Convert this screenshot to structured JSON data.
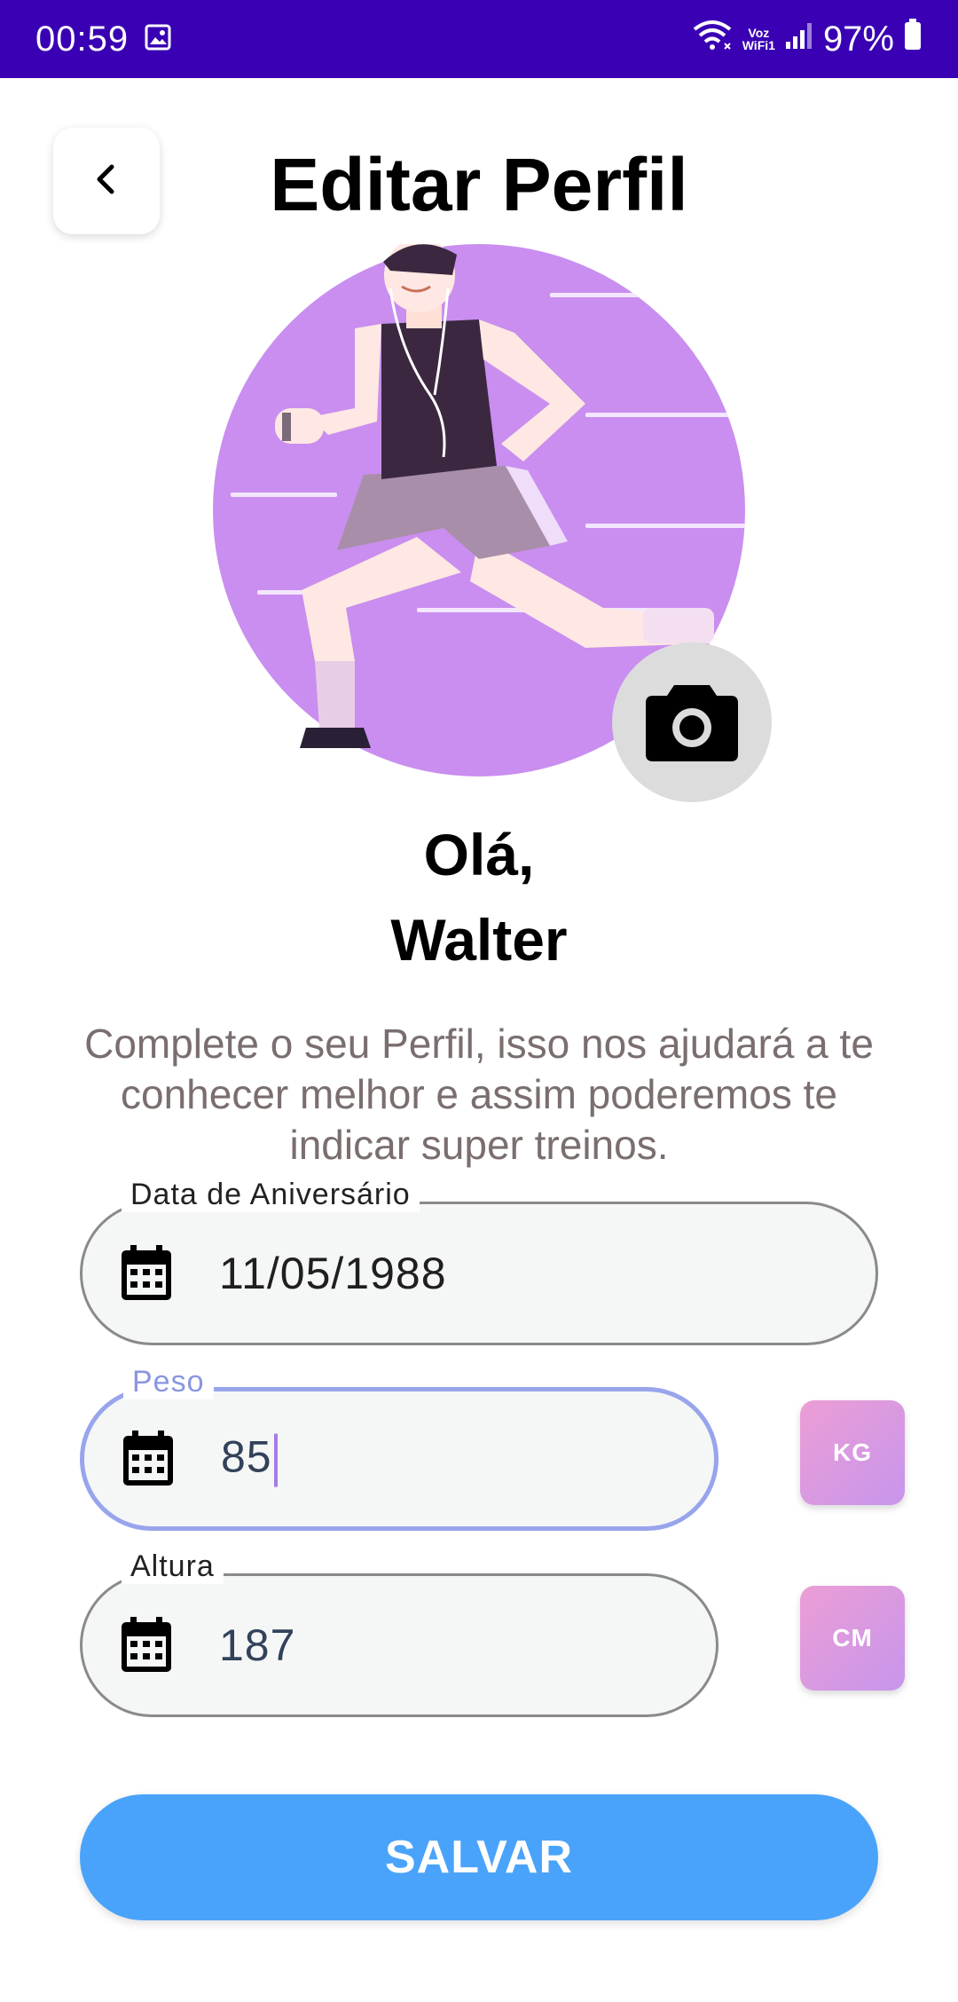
{
  "status_bar": {
    "time": "00:59",
    "vowifi_top": "Voz",
    "vowifi_bottom": "WiFi1",
    "battery": "97%"
  },
  "header": {
    "title": "Editar Perfil"
  },
  "profile": {
    "greeting_line1": "Olá,",
    "greeting_line2": "Walter",
    "subtitle": "Complete o seu Perfil, isso nos ajudará a te conhecer melhor e assim poderemos te indicar super treinos."
  },
  "fields": {
    "birthday": {
      "label": "Data de Aniversário",
      "value": "11/05/1988"
    },
    "weight": {
      "label": "Peso",
      "value": "85",
      "unit": "KG"
    },
    "height": {
      "label": "Altura",
      "value": "187",
      "unit": "CM"
    }
  },
  "actions": {
    "save_label": "SALVAR"
  },
  "colors": {
    "status_bar": "#3a00b4",
    "avatar_bg": "#c98eef",
    "save_button": "#4aa3fa",
    "focused_border": "#98a4ec"
  },
  "icons": {
    "back": "chevron-left-icon",
    "camera": "camera-icon",
    "calendar": "calendar-icon"
  }
}
